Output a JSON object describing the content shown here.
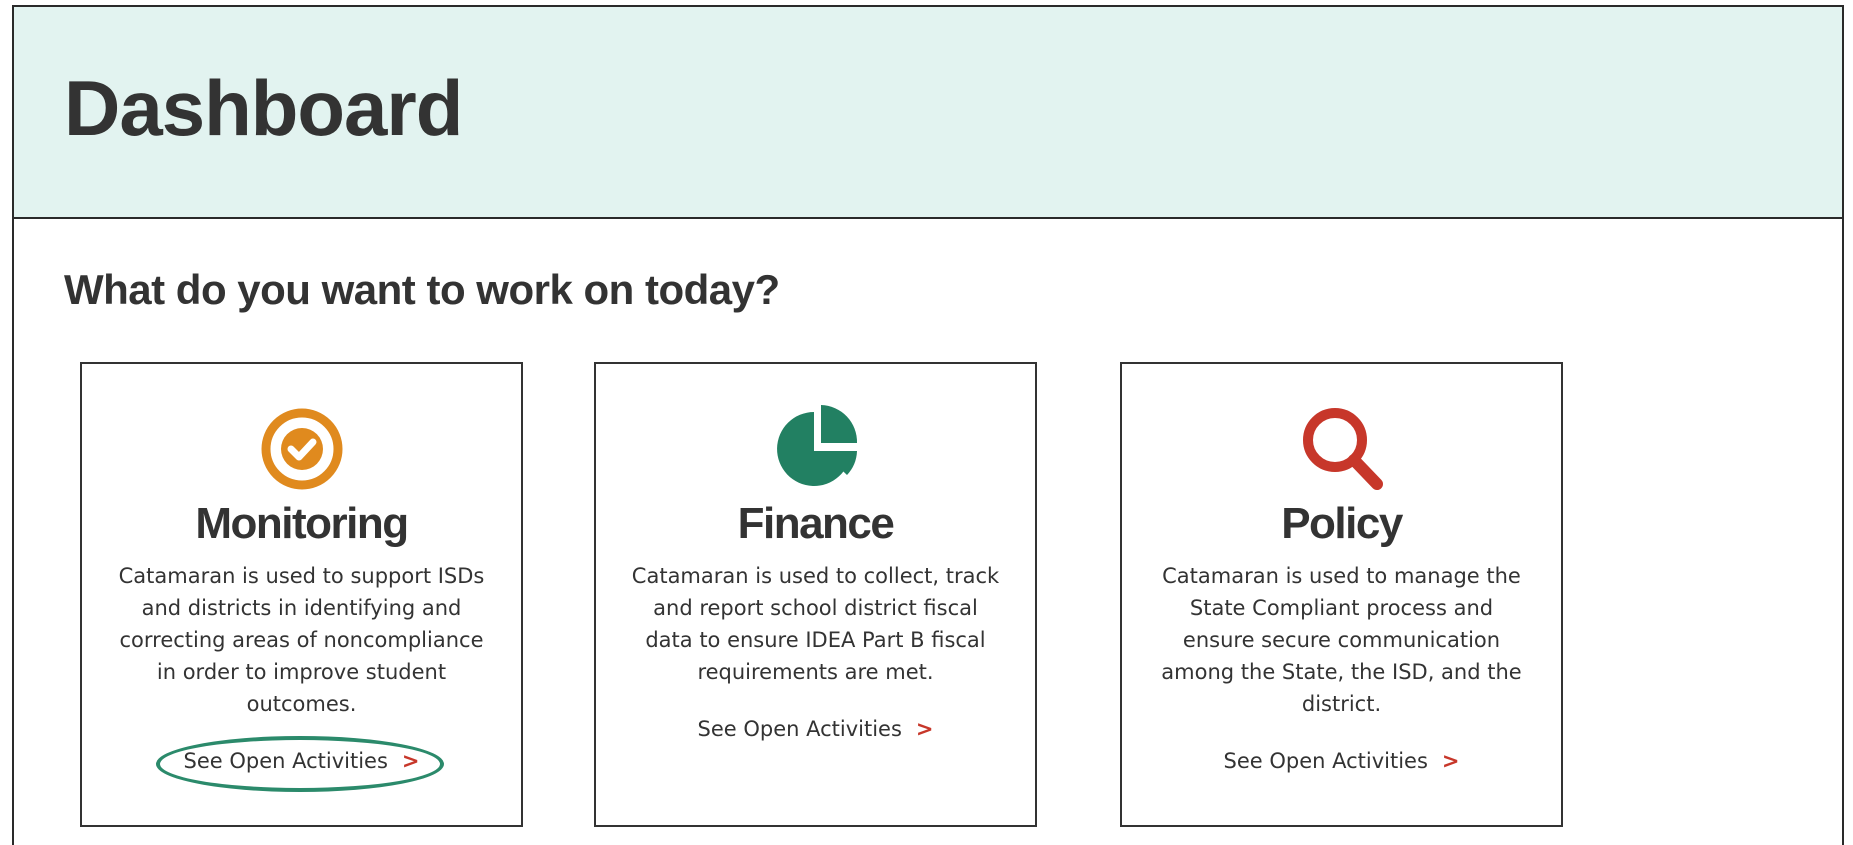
{
  "header": {
    "title": "Dashboard"
  },
  "main": {
    "heading": "What do you want to work on today?",
    "cards": [
      {
        "title": "Monitoring",
        "icon": "check-circle-icon",
        "icon_color": "#e08a1e",
        "description": "Catamaran is used to support ISDs and districts in identifying and correcting areas of noncompliance in order to improve student outcomes.",
        "link_label": "See Open Activities",
        "link_chevron": ">"
      },
      {
        "title": "Finance",
        "icon": "pie-chart-icon",
        "icon_color": "#228062",
        "description": "Catamaran is used to collect, track and report school district fiscal data to ensure IDEA Part B fiscal requirements are met.",
        "link_label": "See Open Activities",
        "link_chevron": ">"
      },
      {
        "title": "Policy",
        "icon": "search-icon",
        "icon_color": "#c7372a",
        "description": "Catamaran is used to manage the State Compliant process and ensure secure communication among the State, the ISD, and the district.",
        "link_label": "See Open Activities",
        "link_chevron": ">"
      }
    ]
  },
  "colors": {
    "header_bg": "#e2f3f0",
    "link_chevron": "#c7372a",
    "highlight_ring": "#2b8a6b"
  }
}
